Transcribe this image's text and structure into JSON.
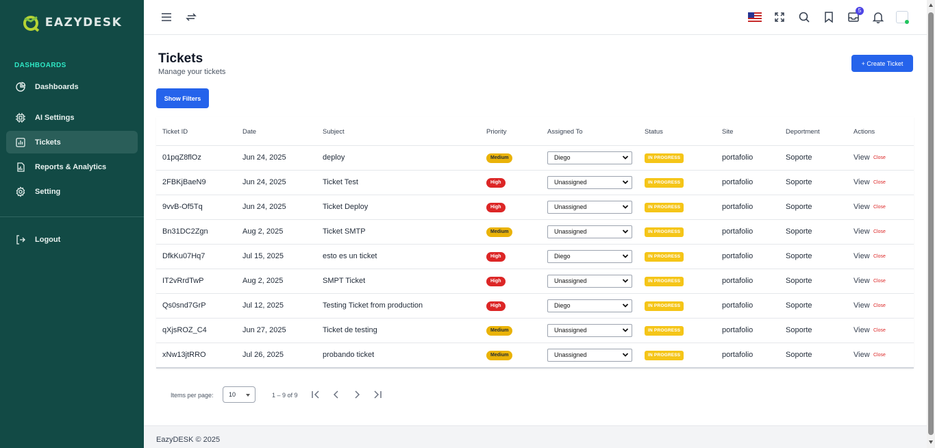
{
  "brand": {
    "name": "EAZYDESK"
  },
  "sidebar": {
    "section": "DASHBOARDS",
    "items": [
      {
        "label": "Dashboards",
        "icon": "pie-chart-icon"
      },
      {
        "label": "AI Settings",
        "icon": "chip-icon"
      },
      {
        "label": "Tickets",
        "icon": "bar-chart-icon",
        "active": true
      },
      {
        "label": "Reports & Analytics",
        "icon": "chart-icon"
      },
      {
        "label": "Setting",
        "icon": "gear-icon"
      }
    ],
    "logout": "Logout"
  },
  "topbar": {
    "notification_count": "5"
  },
  "page": {
    "title": "Tickets",
    "subtitle": "Manage your tickets",
    "create_button": "+ Create Ticket",
    "filters_button": "Show Filters"
  },
  "table": {
    "columns": [
      "Ticket ID",
      "Date",
      "Subject",
      "Priority",
      "Assigned To",
      "Status",
      "Site",
      "Deportment",
      "Actions"
    ],
    "rows": [
      {
        "id": "01pqZ8flOz",
        "date": "Jun 24, 2025",
        "subject": "deploy",
        "priority": "Medium",
        "assigned": "Diego",
        "status": "IN PROGRESS",
        "site": "portafolio",
        "dept": "Soporte",
        "view": "View",
        "close": "Close"
      },
      {
        "id": "2FBKjBaeN9",
        "date": "Jun 24, 2025",
        "subject": "Ticket Test",
        "priority": "High",
        "assigned": "Unassigned",
        "status": "IN PROGRESS",
        "site": "portafolio",
        "dept": "Soporte",
        "view": "View",
        "close": "Close"
      },
      {
        "id": "9vvB-Of5Tq",
        "date": "Jun 24, 2025",
        "subject": "Ticket Deploy",
        "priority": "High",
        "assigned": "Unassigned",
        "status": "IN PROGRESS",
        "site": "portafolio",
        "dept": "Soporte",
        "view": "View",
        "close": "Close"
      },
      {
        "id": "Bn31DC2Zgn",
        "date": "Aug 2, 2025",
        "subject": "Ticket SMTP",
        "priority": "Medium",
        "assigned": "Unassigned",
        "status": "IN PROGRESS",
        "site": "portafolio",
        "dept": "Soporte",
        "view": "View",
        "close": "Close"
      },
      {
        "id": "DfkKu07Hq7",
        "date": "Jul 15, 2025",
        "subject": "esto es un ticket",
        "priority": "High",
        "assigned": "Diego",
        "status": "IN PROGRESS",
        "site": "portafolio",
        "dept": "Soporte",
        "view": "View",
        "close": "Close"
      },
      {
        "id": "IT2vRrdTwP",
        "date": "Aug 2, 2025",
        "subject": "SMPT Ticket",
        "priority": "High",
        "assigned": "Unassigned",
        "status": "IN PROGRESS",
        "site": "portafolio",
        "dept": "Soporte",
        "view": "View",
        "close": "Close"
      },
      {
        "id": "Qs0snd7GrP",
        "date": "Jul 12, 2025",
        "subject": "Testing Ticket from production",
        "priority": "High",
        "assigned": "Diego",
        "status": "IN PROGRESS",
        "site": "portafolio",
        "dept": "Soporte",
        "view": "View",
        "close": "Close"
      },
      {
        "id": "qXjsROZ_C4",
        "date": "Jun 27, 2025",
        "subject": "Ticket de testing",
        "priority": "Medium",
        "assigned": "Unassigned",
        "status": "IN PROGRESS",
        "site": "portafolio",
        "dept": "Soporte",
        "view": "View",
        "close": "Close"
      },
      {
        "id": "xNw13jtRRO",
        "date": "Jul 26, 2025",
        "subject": "probando ticket",
        "priority": "Medium",
        "assigned": "Unassigned",
        "status": "IN PROGRESS",
        "site": "portafolio",
        "dept": "Soporte",
        "view": "View",
        "close": "Close"
      }
    ]
  },
  "pagination": {
    "label": "Items per page:",
    "page_size": "10",
    "range": "1 – 9 of 9"
  },
  "footer": {
    "text": "EazyDESK © 2025"
  },
  "colors": {
    "sidebar": "#124a45",
    "accent": "#2563eb",
    "medium": "#eab308",
    "high": "#dc2626",
    "status": "#f5c518"
  }
}
